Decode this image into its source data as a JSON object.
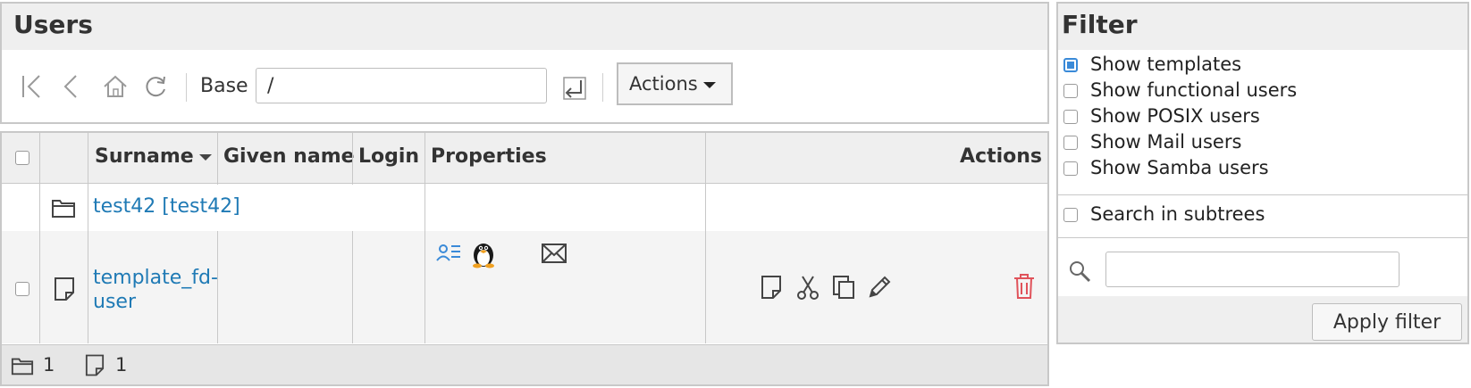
{
  "users_panel": {
    "title": "Users",
    "toolbar": {
      "icons": [
        "first-page-icon",
        "back-icon",
        "home-icon",
        "reload-icon",
        "submit-base-icon"
      ],
      "base_label": "Base",
      "base_value": "/",
      "actions_label": "Actions"
    }
  },
  "list": {
    "columns": [
      "Surname",
      "Given name",
      "Login",
      "Properties",
      "Actions"
    ],
    "sort_column": "Surname",
    "rows": [
      {
        "type": "department",
        "icon": "folder-icon",
        "surname": "test42 [test42]"
      },
      {
        "type": "template",
        "icon": "template-icon",
        "surname": "template_fd-user",
        "surname_lines": [
          "template_fd-",
          "user"
        ],
        "given_name": "",
        "login": "",
        "properties": [
          "user-card-icon",
          "penguin-posix-icon",
          "mail-icon"
        ],
        "actions": [
          "edit-icon",
          "cut-icon",
          "copy-icon",
          "pencil-icon",
          "delete-icon"
        ]
      }
    ],
    "footer": {
      "folders": "1",
      "templates": "1"
    }
  },
  "filter": {
    "title": "Filter",
    "options": [
      {
        "label": "Show templates",
        "checked": true
      },
      {
        "label": "Show functional users",
        "checked": false
      },
      {
        "label": "Show POSIX users",
        "checked": false
      },
      {
        "label": "Show Mail users",
        "checked": false
      },
      {
        "label": "Show Samba users",
        "checked": false
      }
    ],
    "subtree_label": "Search in subtrees",
    "subtree_checked": false,
    "search_value": "",
    "apply_label": "Apply filter"
  },
  "colors": {
    "link": "#1f7ab5",
    "delete": "#e0525a",
    "check": "#3a8ad8"
  }
}
